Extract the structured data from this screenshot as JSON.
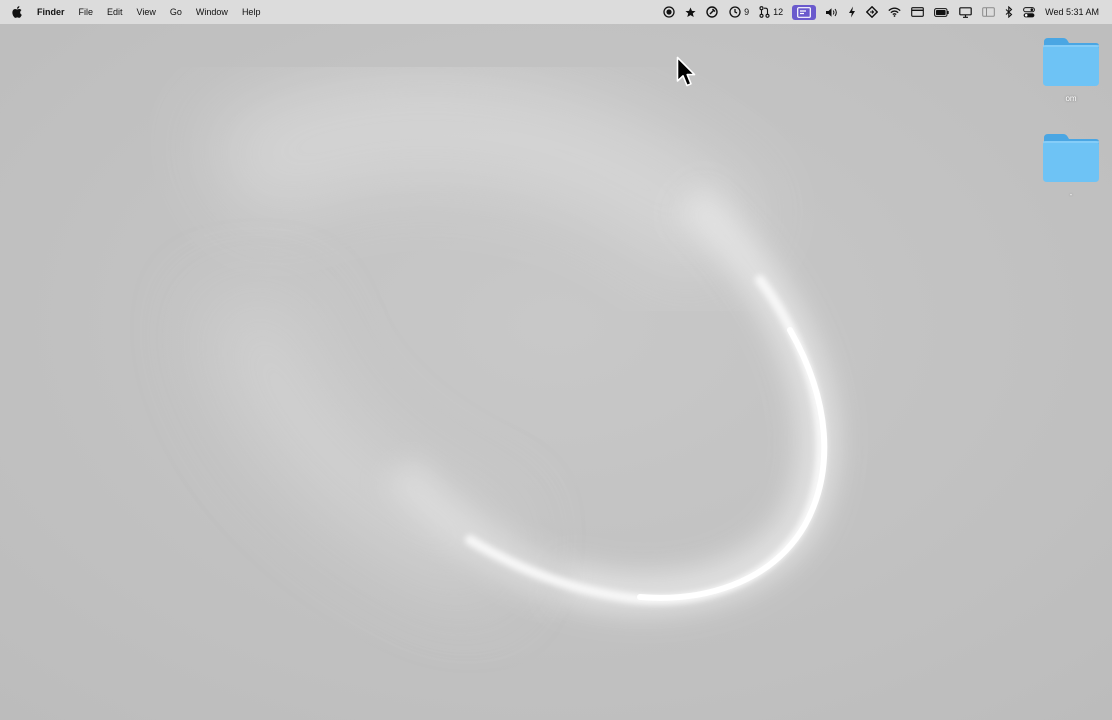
{
  "menubar": {
    "apple_icon": "apple-logo-icon",
    "app_name": "Finder",
    "menus": [
      "File",
      "Edit",
      "View",
      "Go",
      "Window",
      "Help"
    ],
    "status": {
      "timer_count": "9",
      "pull_requests_count": "12",
      "clock": "Wed 5:31 AM"
    },
    "status_icons": [
      "screen-record-icon",
      "star-icon",
      "hammer-icon",
      "timer-icon",
      "pull-request-icon",
      "display-highlight-icon",
      "volume-icon",
      "bolt-icon",
      "diamond-icon",
      "wifi-icon",
      "card-icon",
      "battery-icon",
      "screen-mirror-icon",
      "window-icon",
      "bluetooth-icon",
      "control-center-icon"
    ]
  },
  "desktop": {
    "items": [
      {
        "label": "om",
        "icon": "folder-icon"
      },
      {
        "label": "-",
        "icon": "folder-icon"
      }
    ],
    "colors": {
      "background": "#bfbfbf",
      "folder": "#6ec3f5",
      "folder_tab": "#5aaee6",
      "highlight": "#6a5acd"
    }
  }
}
